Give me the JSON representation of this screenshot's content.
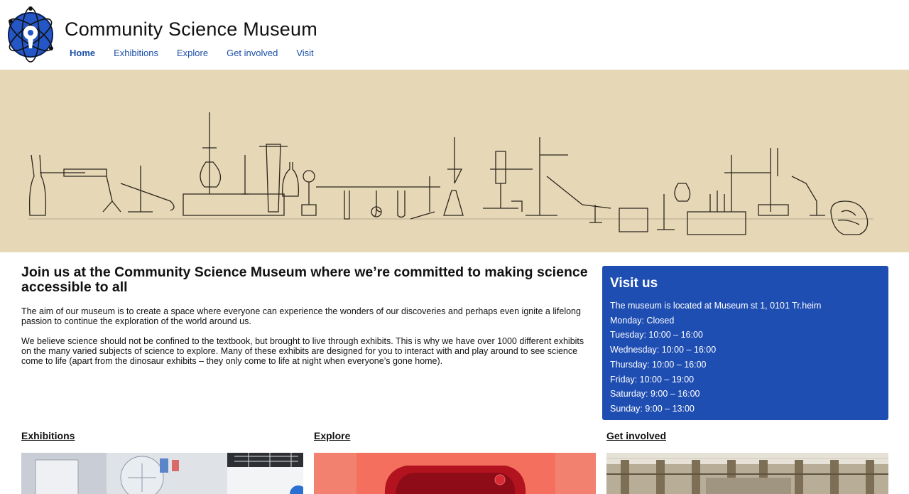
{
  "site": {
    "title": "Community Science Museum",
    "logo_icon": "atom-logo-icon"
  },
  "nav": {
    "items": [
      {
        "label": "Home",
        "active": true
      },
      {
        "label": "Exhibitions",
        "active": false
      },
      {
        "label": "Explore",
        "active": false
      },
      {
        "label": "Get involved",
        "active": false
      },
      {
        "label": "Visit",
        "active": false
      }
    ]
  },
  "hero": {
    "image": "laboratory-equipment-illustration",
    "background": "#e6d7b6"
  },
  "intro": {
    "heading": "Join us at the Community Science Museum where we’re committed to making science accessible to all",
    "paragraph1": "The aim of our museum is to create a space where everyone can experience the wonders of our discoveries and perhaps even ignite a lifelong passion to continue the exploration of the world around us.",
    "paragraph2": "We believe science should not be confined to the textbook, but brought to live through exhibits. This is why we have over 1000 different exhibits on the many varied subjects of science to explore. Many of these exhibits are designed for you to interact with and play around to see science come to life (apart from the dinosaur exhibits – they only come to life at night when everyone’s gone home)."
  },
  "visit": {
    "heading": "Visit us",
    "address": "The museum is located at Museum st 1, 0101 Tr.heim",
    "hours": [
      "Monday: Closed",
      "Tuesday: 10:00 – 16:00",
      "Wednesday: 10:00 – 16:00",
      "Thursday: 10:00 – 16:00",
      "Friday: 10:00 – 19:00",
      "Saturday: 9:00 – 16:00",
      "Sunday: 9:00 – 13:00"
    ],
    "color": "#1f4eb3"
  },
  "cards": [
    {
      "title": "Exhibitions",
      "image": "gallery-interior-photo"
    },
    {
      "title": "Explore",
      "image": "red-vr-headset-photo"
    },
    {
      "title": "Get involved",
      "image": "museum-hall-photo"
    }
  ]
}
